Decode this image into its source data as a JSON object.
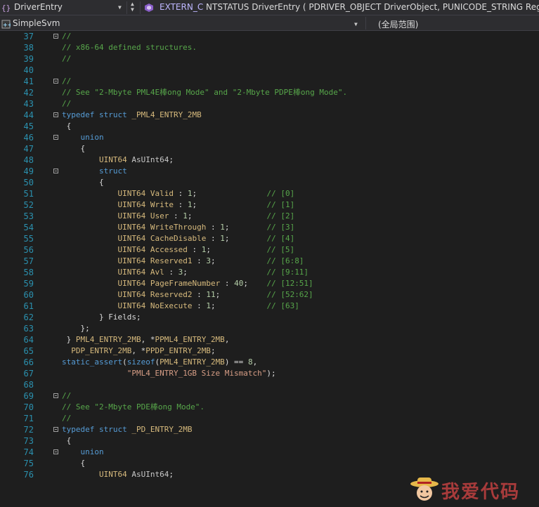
{
  "toolbar": {
    "scope_dropdown": "DriverEntry",
    "signature": {
      "macro": "EXTERN_C",
      "return_type": "NTSTATUS",
      "name": "DriverEntry",
      "params": "( PDRIVER_OBJECT DriverObject, PUNICODE_STRING Regis"
    },
    "project": "SimpleSvm",
    "global_scope": "(全局范围)"
  },
  "editor": {
    "lines": [
      {
        "n": "37",
        "t": "//",
        "k": "cm"
      },
      {
        "n": "38",
        "t": "// x86-64 defined structures.",
        "k": "cm"
      },
      {
        "n": "39",
        "t": "//",
        "k": "cm"
      },
      {
        "n": "40",
        "t": "",
        "k": "pl"
      },
      {
        "n": "41",
        "t": "//",
        "k": "cm"
      },
      {
        "n": "42",
        "t": "// See \"2-Mbyte PML4E棒ong Mode\" and \"2-Mbyte PDPE棒ong Mode\".",
        "k": "cm"
      },
      {
        "n": "43",
        "t": "//",
        "k": "cm"
      },
      {
        "n": "44",
        "t": "typedef struct _PML4_ENTRY_2MB",
        "k": "td"
      },
      {
        "n": "45",
        "t": " {",
        "k": "pl"
      },
      {
        "n": "46",
        "t": "    union",
        "k": "kw"
      },
      {
        "n": "47",
        "t": "    {",
        "k": "pl"
      },
      {
        "n": "48",
        "t": "        UINT64 AsUInt64;",
        "k": "pl"
      },
      {
        "n": "49",
        "t": "        struct",
        "k": "kw"
      },
      {
        "n": "50",
        "t": "        {",
        "k": "pl"
      },
      {
        "n": "51",
        "t": "            UINT64 Valid : 1;               // [0]",
        "k": "fld"
      },
      {
        "n": "52",
        "t": "            UINT64 Write : 1;               // [1]",
        "k": "fld"
      },
      {
        "n": "53",
        "t": "            UINT64 User : 1;                // [2]",
        "k": "fld"
      },
      {
        "n": "54",
        "t": "            UINT64 WriteThrough : 1;        // [3]",
        "k": "fld"
      },
      {
        "n": "55",
        "t": "            UINT64 CacheDisable : 1;        // [4]",
        "k": "fld"
      },
      {
        "n": "56",
        "t": "            UINT64 Accessed : 1;            // [5]",
        "k": "fld"
      },
      {
        "n": "57",
        "t": "            UINT64 Reserved1 : 3;           // [6:8]",
        "k": "fld"
      },
      {
        "n": "58",
        "t": "            UINT64 Avl : 3;                 // [9:11]",
        "k": "fld"
      },
      {
        "n": "59",
        "t": "            UINT64 PageFrameNumber : 40;    // [12:51]",
        "k": "fld"
      },
      {
        "n": "60",
        "t": "            UINT64 Reserved2 : 11;          // [52:62]",
        "k": "fld"
      },
      {
        "n": "61",
        "t": "            UINT64 NoExecute : 1;           // [63]",
        "k": "fld"
      },
      {
        "n": "62",
        "t": "        } Fields;",
        "k": "pl"
      },
      {
        "n": "63",
        "t": "    };",
        "k": "pl"
      },
      {
        "n": "64",
        "t": " } PML4_ENTRY_2MB, *PPML4_ENTRY_2MB,",
        "k": "pl"
      },
      {
        "n": "65",
        "t": "  PDP_ENTRY_2MB, *PPDP_ENTRY_2MB;",
        "k": "pl"
      },
      {
        "n": "66",
        "t": "static_assert(sizeof(PML4_ENTRY_2MB) == 8,",
        "k": "sa"
      },
      {
        "n": "67",
        "t": "              \"PML4_ENTRY_1GB Size Mismatch\");",
        "k": "str"
      },
      {
        "n": "68",
        "t": "",
        "k": "pl"
      },
      {
        "n": "69",
        "t": "//",
        "k": "cm"
      },
      {
        "n": "70",
        "t": "// See \"2-Mbyte PDE棒ong Mode\".",
        "k": "cm"
      },
      {
        "n": "71",
        "t": "//",
        "k": "cm"
      },
      {
        "n": "72",
        "t": "typedef struct _PD_ENTRY_2MB",
        "k": "td"
      },
      {
        "n": "73",
        "t": " {",
        "k": "pl"
      },
      {
        "n": "74",
        "t": "    union",
        "k": "kw"
      },
      {
        "n": "75",
        "t": "    {",
        "k": "pl"
      },
      {
        "n": "76",
        "t": "        UINT64 AsUInt64;",
        "k": "pl"
      }
    ]
  },
  "watermark": {
    "text": "我爱代码"
  },
  "colors": {
    "background": "#1e1e1e",
    "line_number": "#2b91af",
    "comment": "#57a64a",
    "keyword": "#569cd6",
    "macro": "#beb7ff",
    "string": "#d69d85",
    "watermark": "#a83b3b"
  },
  "icons": {
    "scope": "class-scope-icon",
    "member": "function-member-icon",
    "project": "cpp-project-icon"
  }
}
